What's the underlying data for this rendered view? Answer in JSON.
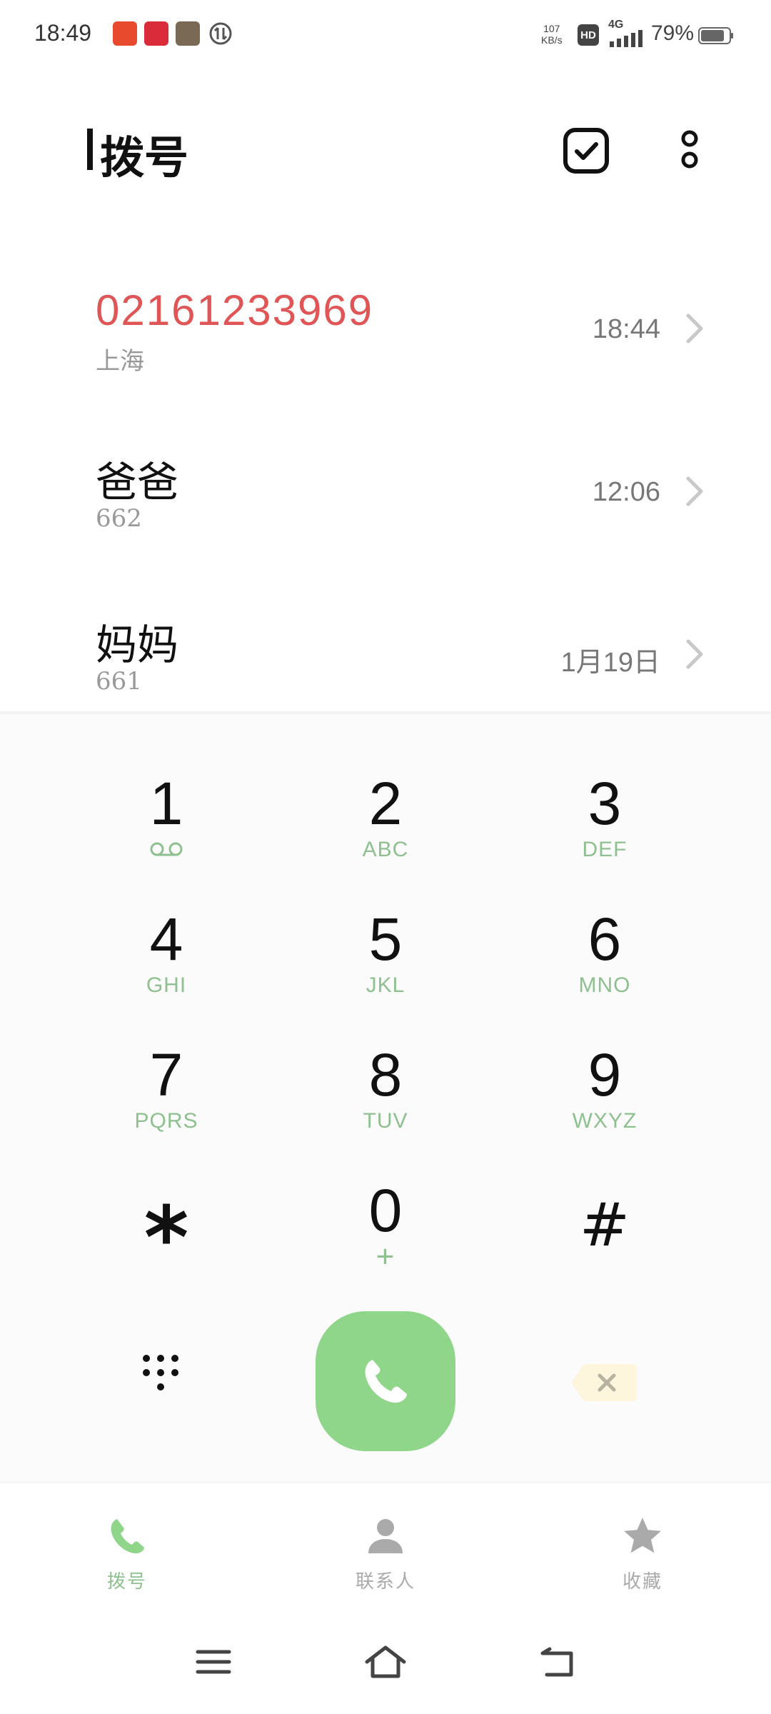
{
  "status_bar": {
    "time": "18:49",
    "speed_value": "107",
    "speed_unit": "KB/s",
    "hd": "HD",
    "network": "4G",
    "battery": "79%"
  },
  "header": {
    "title": "拨号"
  },
  "call_log": [
    {
      "name": "02161233969",
      "subtitle": "上海",
      "time": "18:44",
      "name_color": "#e05555"
    },
    {
      "name": "爸爸",
      "subtitle": "662",
      "time": "12:06",
      "name_color": "#111111"
    },
    {
      "name": "妈妈",
      "subtitle": "661",
      "time": "1月19日",
      "name_color": "#111111"
    }
  ],
  "dialpad": {
    "keys": [
      {
        "digit": "1",
        "letters": "voicemail-icon"
      },
      {
        "digit": "2",
        "letters": "ABC"
      },
      {
        "digit": "3",
        "letters": "DEF"
      },
      {
        "digit": "4",
        "letters": "GHI"
      },
      {
        "digit": "5",
        "letters": "JKL"
      },
      {
        "digit": "6",
        "letters": "MNO"
      },
      {
        "digit": "7",
        "letters": "PQRS"
      },
      {
        "digit": "8",
        "letters": "TUV"
      },
      {
        "digit": "9",
        "letters": "WXYZ"
      },
      {
        "digit": "*",
        "letters": ""
      },
      {
        "digit": "0",
        "letters": "+"
      },
      {
        "digit": "#",
        "letters": ""
      }
    ]
  },
  "bottom_nav": {
    "tabs": [
      {
        "label": "拨号",
        "icon": "phone-icon",
        "active": true
      },
      {
        "label": "联系人",
        "icon": "contact-icon",
        "active": false
      },
      {
        "label": "收藏",
        "icon": "star-icon",
        "active": false
      }
    ]
  },
  "colors": {
    "accent": "#90d68a",
    "accent_text": "#8fc08f",
    "missed_call": "#e05555",
    "inactive": "#aaaaaa"
  }
}
